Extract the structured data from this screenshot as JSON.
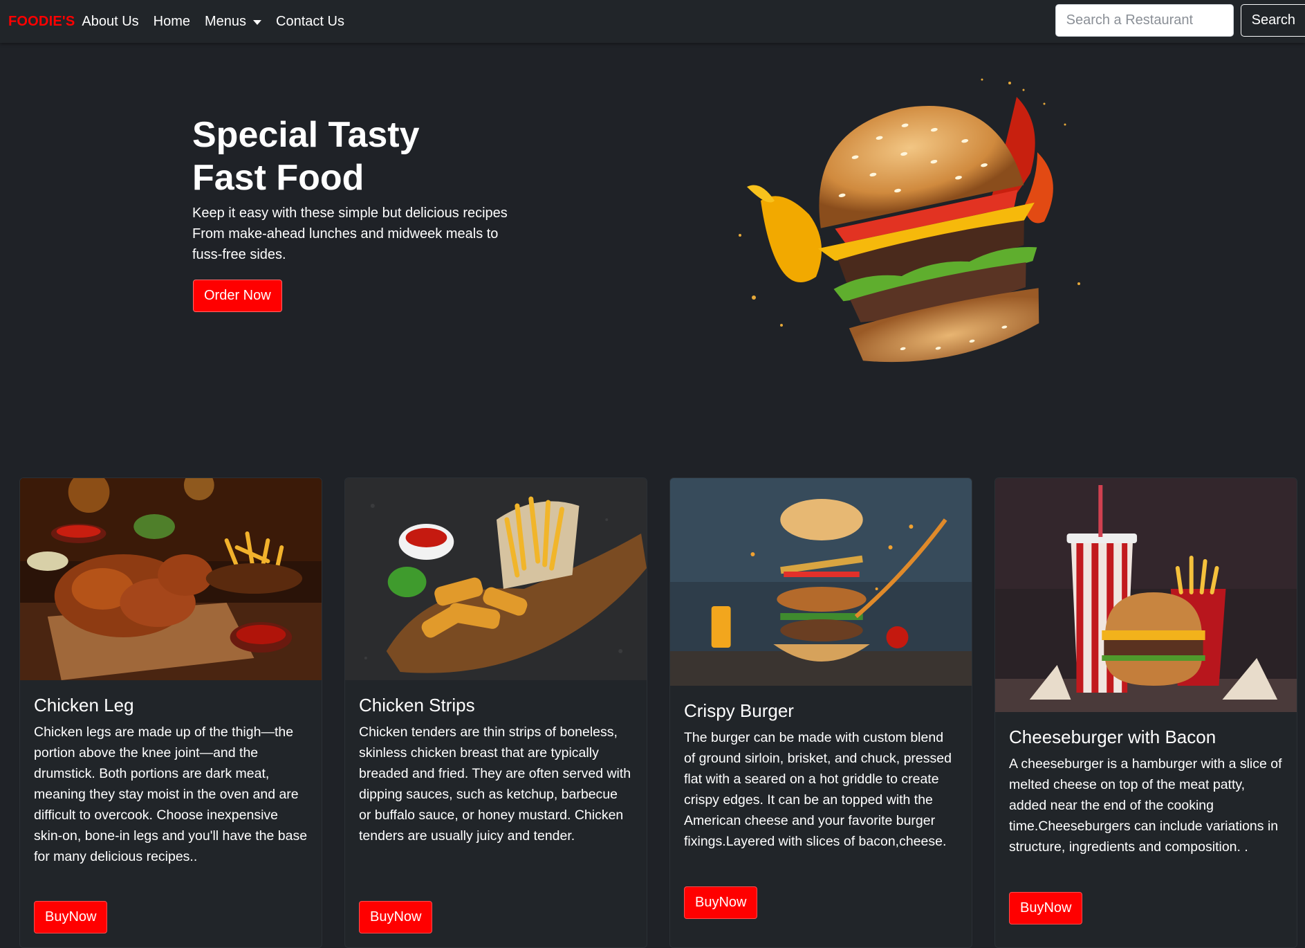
{
  "navbar": {
    "brand": "FOODIE'S",
    "links": [
      "About Us",
      "Home",
      "Menus",
      "Contact Us"
    ],
    "search_placeholder": "Search a Restaurant",
    "search_button": "Search"
  },
  "hero": {
    "title_line1": "Special Tasty",
    "title_line2": "Fast Food",
    "subtitle": "Keep it easy with these simple but delicious recipes From make-ahead lunches and midweek meals to fuss-free sides.",
    "cta": "Order Now"
  },
  "cards": [
    {
      "title": "Chicken Leg",
      "text": "Chicken legs are made up of the thigh—the portion above the knee joint—and the drumstick. Both portions are dark meat, meaning they stay moist in the oven and are difficult to overcook. Choose inexpensive skin-on, bone-in legs and you'll have the base for many delicious recipes..",
      "button": "BuyNow"
    },
    {
      "title": "Chicken Strips",
      "text": "Chicken tenders are thin strips of boneless, skinless chicken breast that are typically breaded and fried. They are often served with dipping sauces, such as ketchup, barbecue or buffalo sauce, or honey mustard. Chicken tenders are usually juicy and tender.",
      "button": "BuyNow"
    },
    {
      "title": "Crispy Burger",
      "text": "The burger can be made with custom blend of ground sirloin, brisket, and chuck, pressed flat with a seared on a hot griddle to create crispy edges. It can be an topped with the American cheese and your favorite burger fixings.Layered with slices of bacon,cheese.",
      "button": "BuyNow"
    },
    {
      "title": "Cheeseburger with Bacon",
      "text": "A cheeseburger is a hamburger with a slice of melted cheese on top of the meat patty, added near the end of the cooking time.Cheeseburgers can include variations in structure, ingredients and composition. .",
      "button": "BuyNow"
    }
  ],
  "colors": {
    "accent": "#ff0000",
    "background": "#1f2227",
    "navbar": "#212529"
  }
}
